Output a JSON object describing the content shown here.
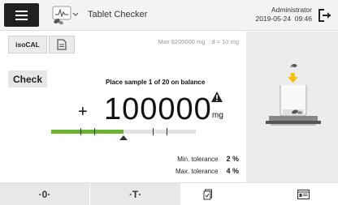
{
  "header": {
    "title": "Tablet Checker",
    "user": "Administrator",
    "date": "2019-05-24",
    "time": "09:46"
  },
  "toolbar": {
    "isocal_label": "isoCAL"
  },
  "balance_info": {
    "max": "Max 8200000 mg",
    "d": "d = 10 mg"
  },
  "check_label": "Check",
  "instruction": "Place sample 1 of 20 on balance",
  "weight": {
    "sign": "+",
    "value": "100000",
    "unit": "mg"
  },
  "progress": {
    "fill_fraction": 0.5
  },
  "tolerances": {
    "min_label": "Min. tolerance",
    "min_value": "2 %",
    "max_label": "Max. tolerance",
    "max_value": "4 %"
  },
  "bottom_buttons": {
    "zero_label": "·0·",
    "tare_label": "·T·"
  },
  "colors": {
    "accent_green": "#6ab32e",
    "arrow_yellow": "#f6c100"
  },
  "icons": [
    "menu-icon",
    "app-icon",
    "logout-icon",
    "document-icon",
    "warning-icon",
    "balance-illustration",
    "protocol-icon",
    "results-icon"
  ]
}
